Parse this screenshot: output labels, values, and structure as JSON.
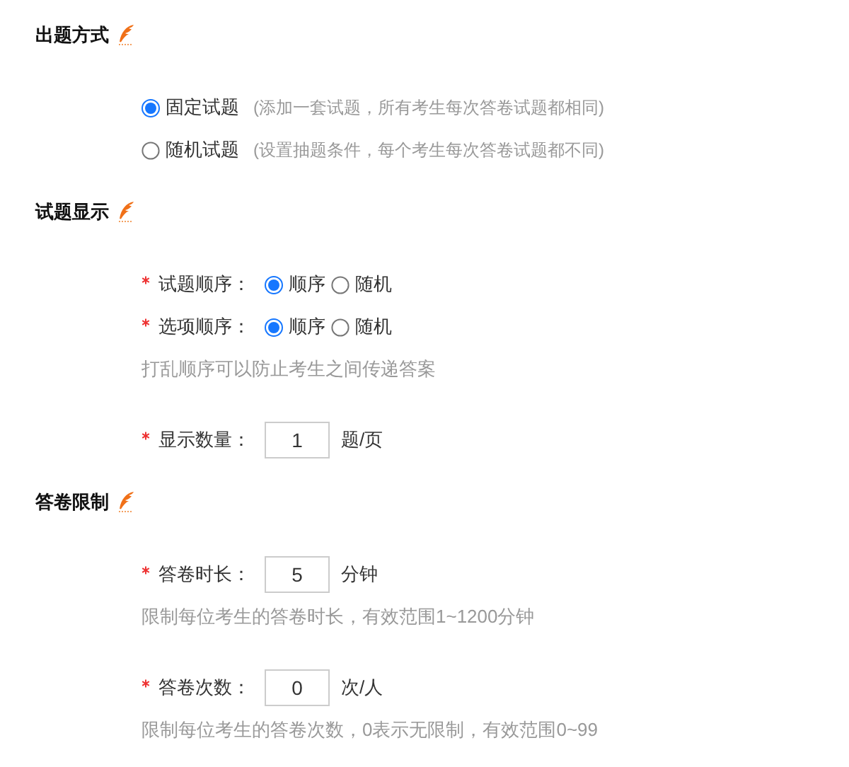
{
  "sections": [
    {
      "title": "出题方式",
      "items": [
        {
          "kind": "choice",
          "label": "固定试题",
          "note": "(添加一套试题，所有考生每次答卷试题都相同)",
          "selected": true
        },
        {
          "kind": "choice",
          "label": "随机试题",
          "note": "(设置抽题条件，每个考生每次答卷试题都不同)",
          "selected": false
        }
      ]
    },
    {
      "title": "试题显示",
      "items": [
        {
          "kind": "radio_group",
          "required": true,
          "label": "试题顺序：",
          "options": [
            {
              "label": "顺序",
              "selected": true
            },
            {
              "label": "随机",
              "selected": false
            }
          ]
        },
        {
          "kind": "radio_group",
          "required": true,
          "label": "选项顺序：",
          "options": [
            {
              "label": "顺序",
              "selected": true
            },
            {
              "label": "随机",
              "selected": false
            }
          ]
        },
        {
          "kind": "hint",
          "text": "打乱顺序可以防止考生之间传递答案"
        },
        {
          "kind": "number_field",
          "required": true,
          "label": "显示数量：",
          "value": "1",
          "unit": "题/页"
        }
      ]
    },
    {
      "title": "答卷限制",
      "items": [
        {
          "kind": "number_field",
          "required": true,
          "label": "答卷时长：",
          "value": "5",
          "unit": "分钟"
        },
        {
          "kind": "hint",
          "text": "限制每位考生的答卷时长，有效范围1~1200分钟"
        },
        {
          "kind": "number_field",
          "required": true,
          "label": "答卷次数：",
          "value": "0",
          "unit": "次/人"
        },
        {
          "kind": "hint",
          "text": "限制每位考生的答卷次数，0表示无限制，有效范围0~99"
        }
      ]
    }
  ]
}
